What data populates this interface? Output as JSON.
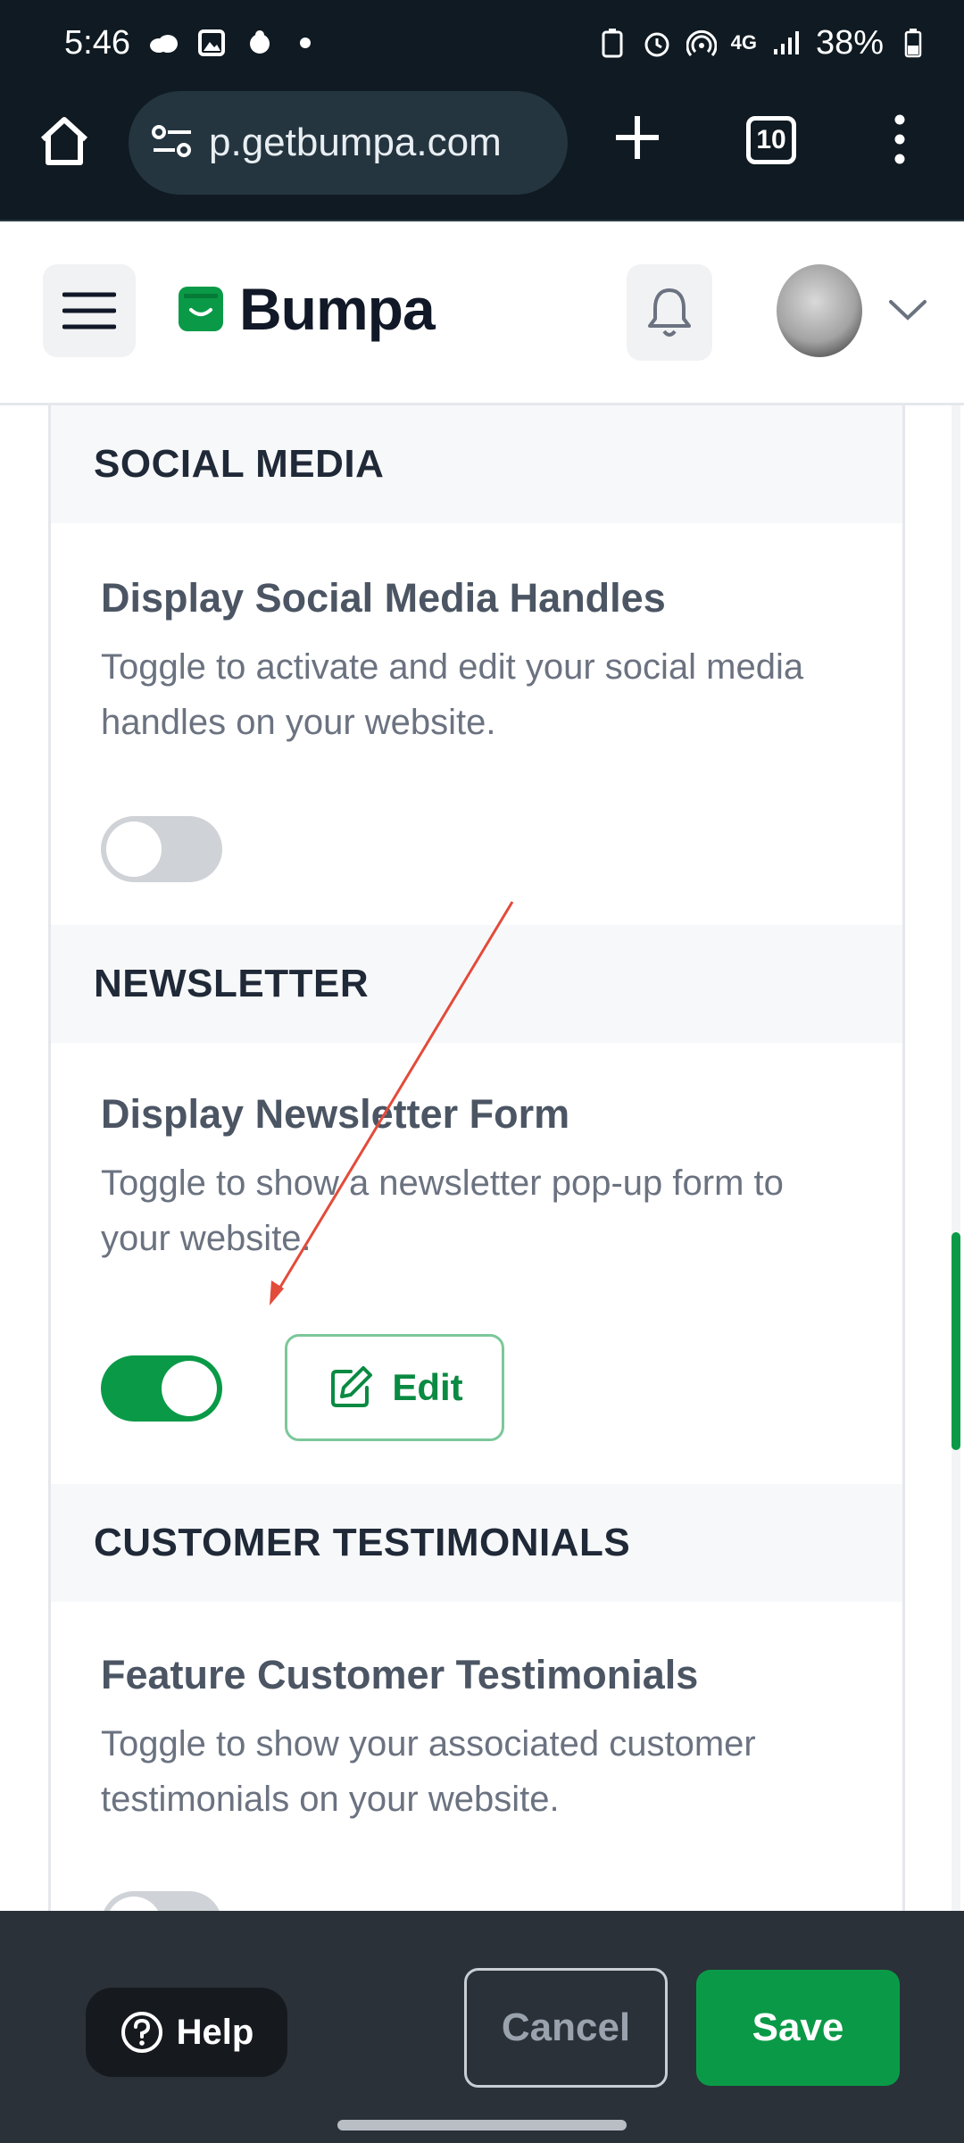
{
  "status_bar": {
    "time": "5:46",
    "network": "4G",
    "battery": "38%"
  },
  "browser": {
    "url": "p.getbumpa.com",
    "tab_count": "10"
  },
  "header": {
    "brand_name": "Bumpa",
    "brand_color": "#0a9a47"
  },
  "sections": {
    "social": {
      "heading": "SOCIAL MEDIA",
      "title": "Display Social Media Handles",
      "description": "Toggle to activate and edit your social media handles on your website.",
      "toggle_on": false
    },
    "newsletter": {
      "heading": "NEWSLETTER",
      "title": "Display Newsletter Form",
      "description": "Toggle to show a newsletter pop-up form to your website.",
      "toggle_on": true,
      "edit_label": "Edit"
    },
    "testimonials": {
      "heading": "CUSTOMER TESTIMONIALS",
      "title": "Feature Customer Testimonials",
      "description": "Toggle to show your associated customer testimonials on your website.",
      "toggle_on": false
    }
  },
  "footer": {
    "help_label": "Help",
    "cancel_label": "Cancel",
    "save_label": "Save"
  },
  "annotation": {
    "arrow_color": "#e34b3a"
  }
}
